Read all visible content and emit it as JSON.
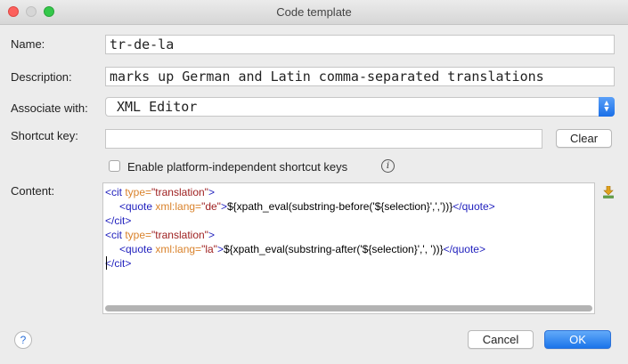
{
  "window": {
    "title": "Code template"
  },
  "form": {
    "name_label": "Name:",
    "name_value": "tr-de-la",
    "description_label": "Description:",
    "description_value": "marks up German and Latin comma-separated translations",
    "associate_label": "Associate with:",
    "associate_value": "XML Editor",
    "shortcut_label": "Shortcut key:",
    "shortcut_value": "",
    "clear_button": "Clear",
    "platform_checkbox_label": "Enable platform-independent shortcut keys",
    "platform_checkbox_checked": false,
    "content_label": "Content:"
  },
  "content": {
    "line1": {
      "open": "<cit ",
      "attr": "type=",
      "val": "\"translation\"",
      "close": ">"
    },
    "line2": {
      "open": "<quote ",
      "attr": "xml:lang=",
      "val": "\"de\"",
      "close": ">",
      "text": "${xpath_eval(substring-before('${selection}',','))}",
      "end": "</quote>"
    },
    "line3": {
      "end": "</cit>"
    },
    "line4": {
      "open": "<cit ",
      "attr": "type=",
      "val": "\"translation\"",
      "close": ">"
    },
    "line5": {
      "open": "<quote ",
      "attr": "xml:lang=",
      "val": "\"la\"",
      "close": ">",
      "text": "${xpath_eval(substring-after('${selection}',', '))}",
      "end": "</quote>"
    },
    "line6": {
      "end": "</cit>"
    }
  },
  "footer": {
    "help_label": "?",
    "cancel_button": "Cancel",
    "ok_button": "OK"
  },
  "colors": {
    "tag": "#1f1fbd",
    "attribute": "#d9822b",
    "value": "#9e2020",
    "primary_button": "#1b74ea"
  },
  "icons": {
    "info": "info-icon",
    "download": "download-icon",
    "help": "help-icon"
  }
}
